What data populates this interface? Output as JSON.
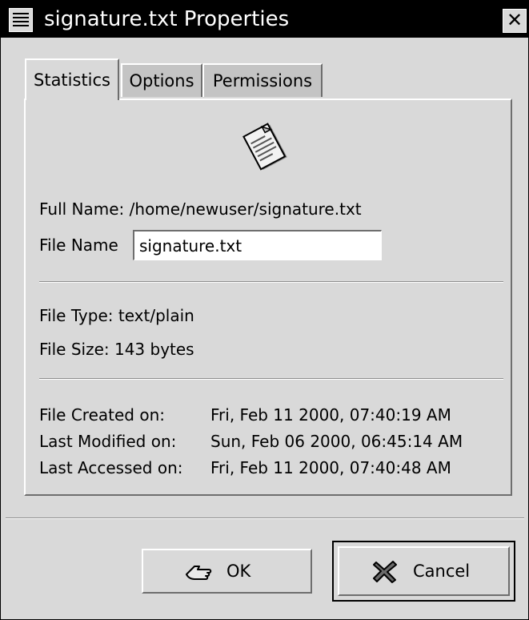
{
  "window": {
    "title": "signature.txt Properties"
  },
  "tabs": [
    {
      "label": "Statistics",
      "active": true
    },
    {
      "label": "Options",
      "active": false
    },
    {
      "label": "Permissions",
      "active": false
    }
  ],
  "file_icon": "text-document-icon",
  "info": {
    "full_name": "Full Name: /home/newuser/signature.txt",
    "file_name_label": "File Name",
    "file_name_value": "signature.txt",
    "file_type": "File Type: text/plain",
    "file_size": "File Size: 143 bytes"
  },
  "dates": [
    {
      "label": "File Created on:",
      "value": "Fri, Feb 11 2000,  07:40:19 AM"
    },
    {
      "label": "Last Modified on:",
      "value": "Sun, Feb 06 2000,  06:45:14 AM"
    },
    {
      "label": "Last Accessed on:",
      "value": "Fri, Feb 11 2000,  07:40:48 AM"
    }
  ],
  "buttons": {
    "ok": "OK",
    "cancel": "Cancel"
  }
}
